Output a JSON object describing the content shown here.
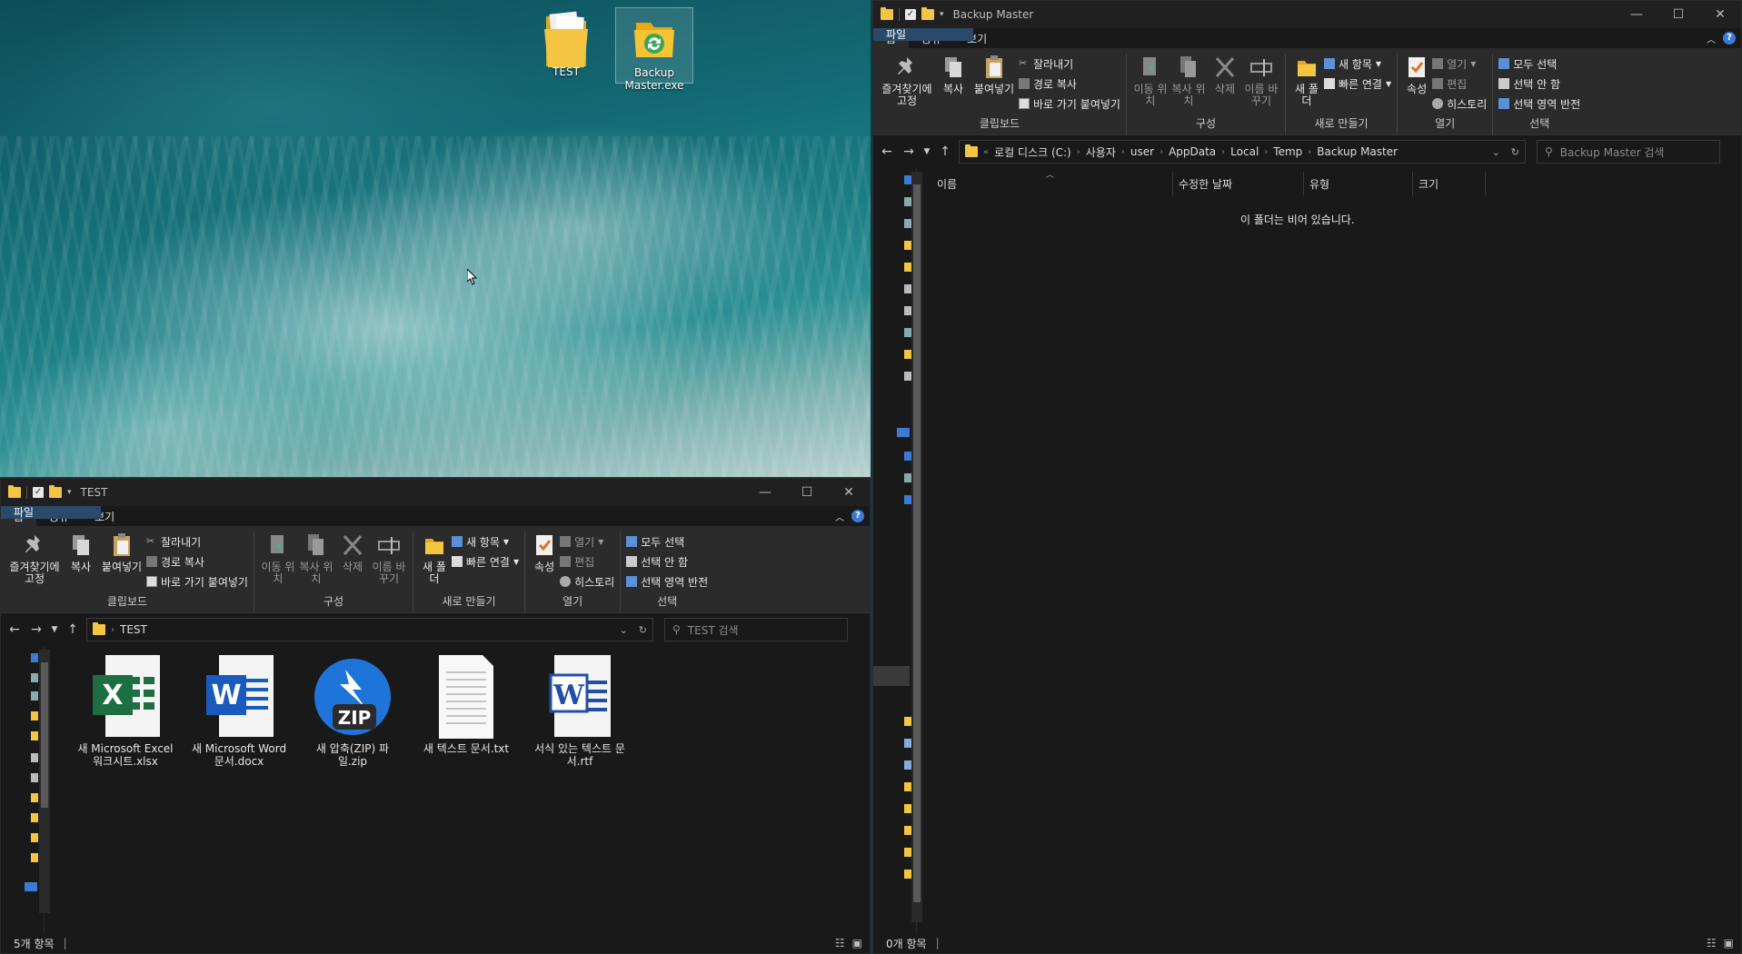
{
  "desktop": {
    "icons": [
      {
        "label": "TEST"
      },
      {
        "label": "Backup Master.exe"
      }
    ]
  },
  "ribbon": {
    "tabs": [
      "파일",
      "홈",
      "공유",
      "보기"
    ],
    "clipboard": {
      "pin": "즐겨찾기에 고정",
      "copy": "복사",
      "paste": "붙여넣기",
      "cut": "잘라내기",
      "copy_path": "경로 복사",
      "paste_shortcut": "바로 가기 붙여넣기",
      "label": "클립보드"
    },
    "organize": {
      "move_to": "이동 위치",
      "copy_to": "복사 위치",
      "delete": "삭제",
      "rename": "이름 바꾸기",
      "label": "구성"
    },
    "new": {
      "new_folder": "새 폴더",
      "new_item": "새 항목",
      "easy_access": "빠른 연결",
      "label": "새로 만들기"
    },
    "open": {
      "properties": "속성",
      "open": "열기",
      "edit": "편집",
      "history": "히스토리",
      "label": "열기"
    },
    "select": {
      "select_all": "모두 선택",
      "select_none": "선택 안 함",
      "invert": "선택 영역 반전",
      "label": "선택"
    }
  },
  "window_test": {
    "title": "TEST",
    "address": [
      "TEST"
    ],
    "search_placeholder": "TEST 검색",
    "files": [
      {
        "name": "새 Microsoft Excel 워크시트.xlsx",
        "icon": "excel-icon",
        "color": "#1d6f42"
      },
      {
        "name": "새 Microsoft Word 문서.docx",
        "icon": "word-icon",
        "color": "#185abd"
      },
      {
        "name": "새 압축(ZIP) 파일.zip",
        "icon": "zip-icon",
        "color": "#1e74d8"
      },
      {
        "name": "새 텍스트 문서.txt",
        "icon": "text-file-icon",
        "color": "#ffffff"
      },
      {
        "name": "서식 있는 텍스트 문서.rtf",
        "icon": "rtf-icon",
        "color": "#1f4fa8"
      }
    ],
    "status": "5개 항목"
  },
  "window_backup": {
    "title": "Backup Master",
    "address": [
      "로컬 디스크 (C:)",
      "사용자",
      "user",
      "AppData",
      "Local",
      "Temp",
      "Backup Master"
    ],
    "search_placeholder": "Backup Master 검색",
    "columns": [
      "이름",
      "수정한 날짜",
      "유형",
      "크기"
    ],
    "empty_message": "이 폴더는 비어 있습니다.",
    "status": "0개 항목"
  },
  "colors": {
    "accent": "#2a4a6b",
    "folder": "#f4c542",
    "window_bg": "#191919",
    "ribbon_bg": "#2b2b2b"
  }
}
